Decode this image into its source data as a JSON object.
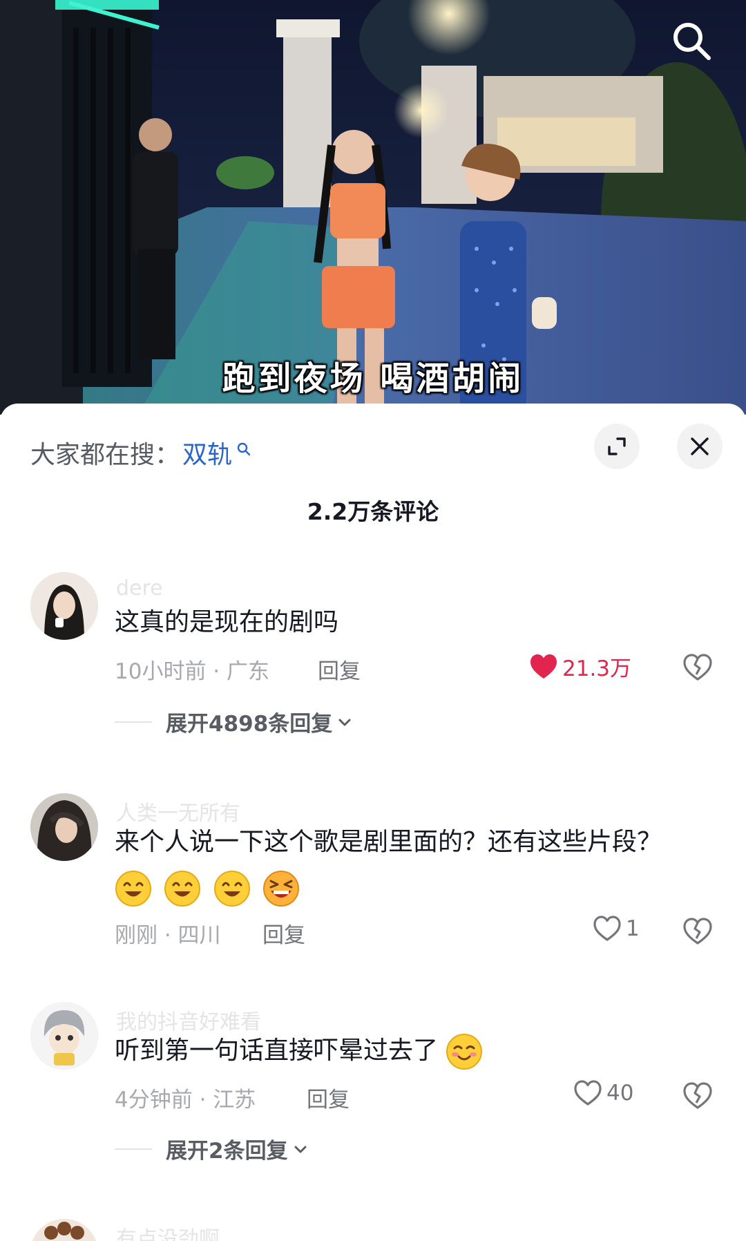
{
  "video": {
    "subtitle": "跑到夜场 喝酒胡闹",
    "search_icon": "search-icon"
  },
  "sheet": {
    "hot_search_label": "大家都在搜：",
    "hot_search_keyword": "双轨",
    "comment_count_title": "2.2万条评论",
    "expand_icon": "expand-icon",
    "close_icon": "close-icon"
  },
  "comments": [
    {
      "username": "dere",
      "text": "这真的是现在的剧吗",
      "meta": "10小时前 · 广东",
      "reply_label": "回复",
      "likes": "21.3万",
      "liked": true,
      "expand_replies": "展开4898条回复"
    },
    {
      "username": "人类一无所有",
      "text": "来个人说一下这个歌是剧里面的？还有这些片段？",
      "emojis": [
        "smile-emoji",
        "smile-emoji",
        "smile-emoji",
        "laugh-emoji"
      ],
      "meta": "刚刚 · 四川",
      "reply_label": "回复",
      "likes": "1",
      "liked": false
    },
    {
      "username": "我的抖音好难看",
      "text": "听到第一句话直接吓晕过去了",
      "emojis": [
        "blush-emoji"
      ],
      "meta": "4分钟前 · 江苏",
      "reply_label": "回复",
      "likes": "40",
      "liked": false,
      "expand_replies": "展开2条回复"
    },
    {
      "username": "有点没劲啊"
    }
  ],
  "colors": {
    "accent_like": "#e1254e",
    "keyword_blue": "#2a66c9"
  }
}
